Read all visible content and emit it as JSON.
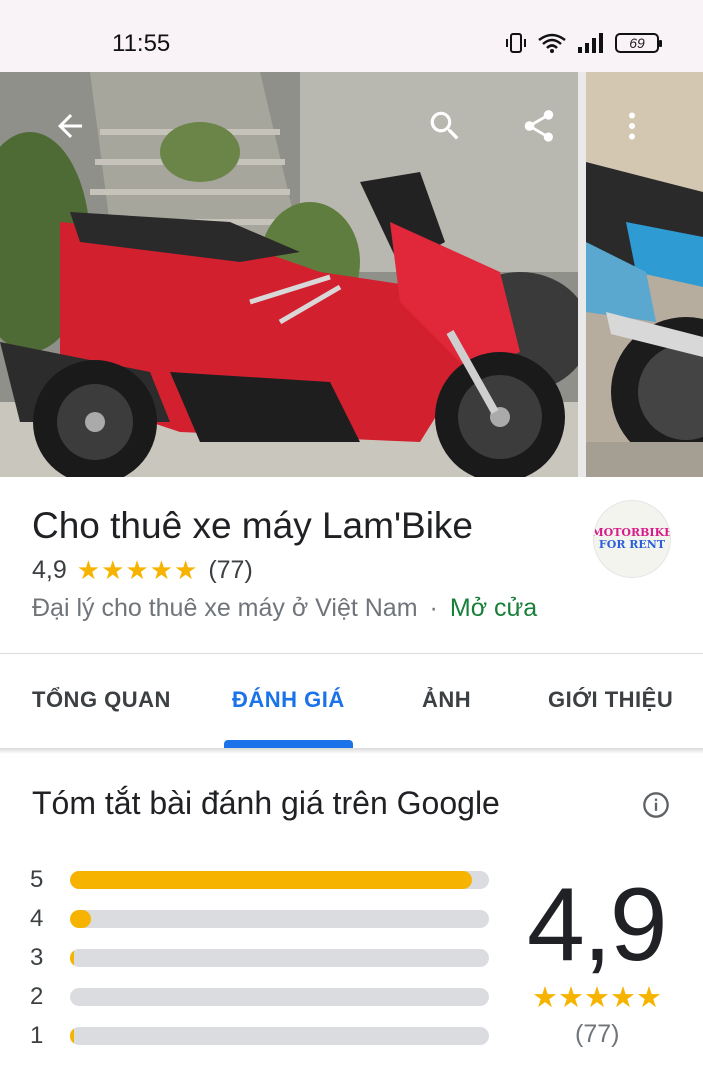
{
  "status_bar": {
    "time": "11:55",
    "battery": "69"
  },
  "photos": {
    "back_icon": "arrow-back-icon",
    "search_icon": "search-icon",
    "share_icon": "share-icon",
    "more_icon": "more-vert-icon"
  },
  "place": {
    "name": "Cho thuê xe máy Lam'Bike",
    "rating": "4,9",
    "stars": "★★★★★",
    "review_count": "(77)",
    "category": "Đại lý cho thuê xe máy ở Việt Nam",
    "separator": "·",
    "open_status": "Mở cửa",
    "logo_line1": "MOTORBIKE",
    "logo_line2": "FOR RENT"
  },
  "tabs": [
    {
      "label": "TỔNG QUAN",
      "active": false
    },
    {
      "label": "ĐÁNH GIÁ",
      "active": true
    },
    {
      "label": "ẢNH",
      "active": false
    },
    {
      "label": "GIỚI THIỆU",
      "active": false
    }
  ],
  "review_summary": {
    "title": "Tóm tắt bài đánh giá trên Google",
    "info_icon": "info-icon",
    "distribution": [
      {
        "stars": "5",
        "fraction": 0.96
      },
      {
        "stars": "4",
        "fraction": 0.05
      },
      {
        "stars": "3",
        "fraction": 0.01
      },
      {
        "stars": "2",
        "fraction": 0.0
      },
      {
        "stars": "1",
        "fraction": 0.01
      }
    ],
    "average": "4,9",
    "stars": "★★★★★",
    "count": "(77)"
  },
  "colors": {
    "accent": "#1a73e8",
    "star": "#f6b400",
    "open": "#188038"
  }
}
